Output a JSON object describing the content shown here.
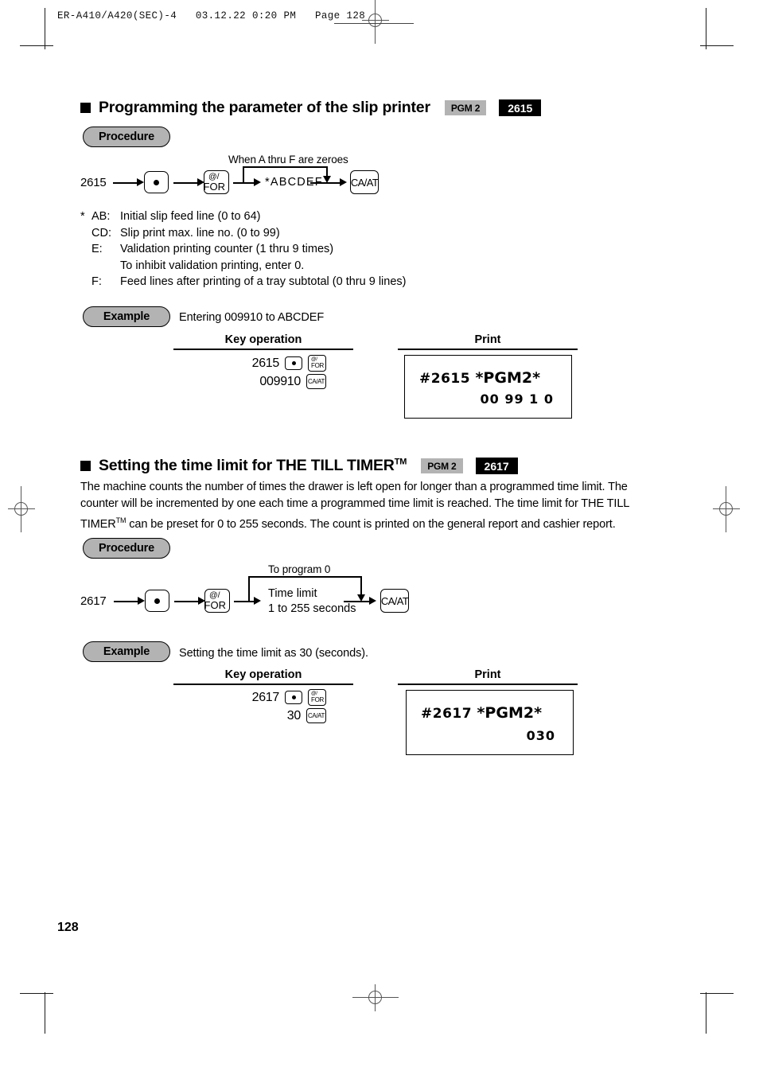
{
  "print_header": {
    "text": "ER-A410/A420(SEC)-4   03.12.22 0:20 PM   Page 128"
  },
  "page_number": "128",
  "sections": [
    {
      "title": "Programming the parameter of the slip printer",
      "badge_mode": "PGM 2",
      "badge_code": "2615",
      "procedure_label": "Procedure",
      "flow": {
        "start_code": "2615",
        "key_decimal": "•",
        "key_for_line1": "@/",
        "key_for_line2": "FOR",
        "entry_label": "*ABCDEF",
        "bypass_note": "When A thru F are zeroes",
        "key_finish": "CA/AT"
      },
      "legend": [
        {
          "star": "*",
          "tag": "AB:",
          "desc": "Initial slip feed line (0 to 64)"
        },
        {
          "star": "",
          "tag": "CD:",
          "desc": "Slip print max. line no. (0 to 99)"
        },
        {
          "star": "",
          "tag": "E:",
          "desc": "Validation printing counter (1 thru 9 times)"
        },
        {
          "star": "",
          "tag": "",
          "desc": "To inhibit validation printing, enter 0."
        },
        {
          "star": "",
          "tag": "F:",
          "desc": "Feed lines after printing of a tray subtotal (0 thru 9 lines)"
        }
      ],
      "example": {
        "label": "Example",
        "description": "Entering 009910 to ABCDEF",
        "keyop_header": "Key operation",
        "print_header": "Print",
        "keyop_rows": [
          {
            "value": "2615",
            "keys": [
              "dot",
              "for"
            ]
          },
          {
            "value": "009910",
            "keys": [
              "caat"
            ]
          }
        ],
        "receipt": {
          "line1_prefix": "#2615",
          "line1_mode": "*PGM2*",
          "line2": "00 99 1 0"
        }
      }
    },
    {
      "title": "Setting the time limit for THE TILL TIMER",
      "title_tm": "TM",
      "badge_mode": "PGM 2",
      "badge_code": "2617",
      "body": "The machine counts the number of times the drawer is left open for longer than a programmed time limit.  The counter will be incremented by one each time a programmed time limit is reached.   The time limit for THE TILL TIMER",
      "body_tm": "TM",
      "body_cont": " can be preset for 0 to 255 seconds.  The count is printed on the general report and cashier report.",
      "procedure_label": "Procedure",
      "flow": {
        "start_code": "2617",
        "key_decimal": "•",
        "key_for_line1": "@/",
        "key_for_line2": "FOR",
        "entry_line1": "Time limit",
        "entry_line2": "1 to 255 seconds",
        "bypass_note": "To program 0",
        "key_finish": "CA/AT"
      },
      "example": {
        "label": "Example",
        "description": "Setting the time limit as 30 (seconds).",
        "keyop_header": "Key operation",
        "print_header": "Print",
        "keyop_rows": [
          {
            "value": "2617",
            "keys": [
              "dot",
              "for"
            ]
          },
          {
            "value": "30",
            "keys": [
              "caat"
            ]
          }
        ],
        "receipt": {
          "line1_prefix": "#2617",
          "line1_mode": "*PGM2*",
          "line2": "030"
        }
      }
    }
  ],
  "colors": {
    "badge_mode_bg": "#b3b3b3",
    "badge_code_bg": "#000000",
    "pill_bg": "#b3b3b3",
    "ink": "#000000"
  }
}
